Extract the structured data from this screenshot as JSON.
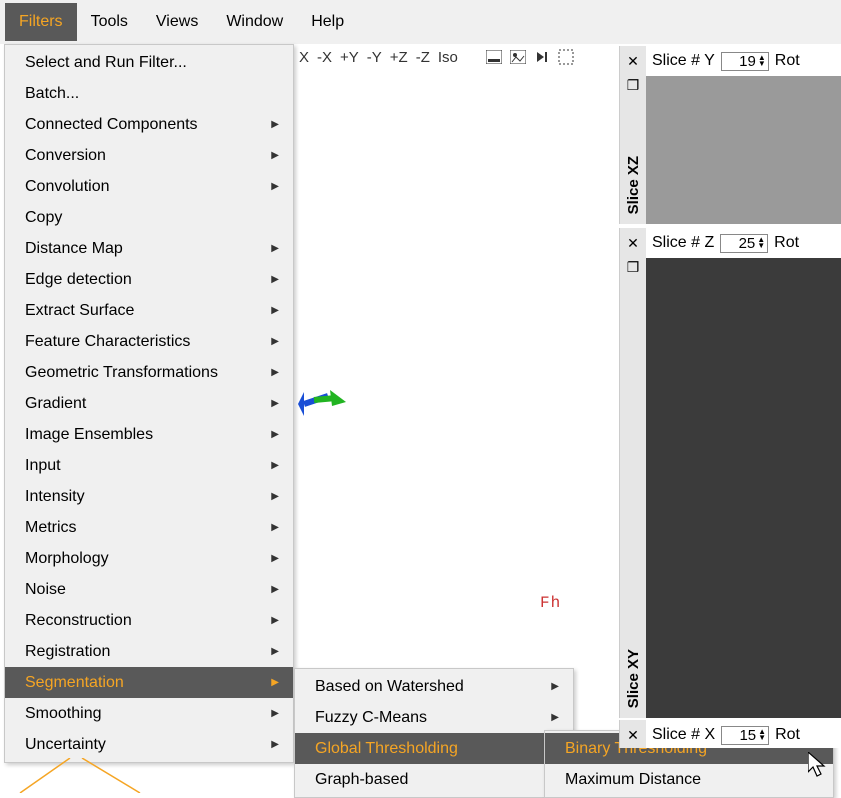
{
  "menubar": {
    "items": [
      {
        "label": "Filters",
        "active": true
      },
      {
        "label": "Tools"
      },
      {
        "label": "Views"
      },
      {
        "label": "Window"
      },
      {
        "label": "Help"
      }
    ]
  },
  "filters_menu": {
    "items": [
      {
        "label": "Select and Run Filter..."
      },
      {
        "label": "Batch..."
      },
      {
        "label": "Connected Components",
        "submenu": true
      },
      {
        "label": "Conversion",
        "submenu": true
      },
      {
        "label": "Convolution",
        "submenu": true
      },
      {
        "label": "Copy"
      },
      {
        "label": "Distance Map",
        "submenu": true
      },
      {
        "label": "Edge detection",
        "submenu": true
      },
      {
        "label": "Extract Surface",
        "submenu": true
      },
      {
        "label": "Feature Characteristics",
        "submenu": true
      },
      {
        "label": "Geometric Transformations",
        "submenu": true
      },
      {
        "label": "Gradient",
        "submenu": true
      },
      {
        "label": "Image Ensembles",
        "submenu": true
      },
      {
        "label": "Input",
        "submenu": true
      },
      {
        "label": "Intensity",
        "submenu": true
      },
      {
        "label": "Metrics",
        "submenu": true
      },
      {
        "label": "Morphology",
        "submenu": true
      },
      {
        "label": "Noise",
        "submenu": true
      },
      {
        "label": "Reconstruction",
        "submenu": true
      },
      {
        "label": "Registration",
        "submenu": true
      },
      {
        "label": "Segmentation",
        "submenu": true,
        "highlight": true
      },
      {
        "label": "Smoothing",
        "submenu": true
      },
      {
        "label": "Uncertainty",
        "submenu": true
      }
    ]
  },
  "segmentation_menu": {
    "items": [
      {
        "label": "Based on Watershed",
        "submenu": true
      },
      {
        "label": "Fuzzy C-Means",
        "submenu": true
      },
      {
        "label": "Global Thresholding",
        "submenu": true,
        "highlight": true
      },
      {
        "label": "Graph-based",
        "submenu": true
      }
    ]
  },
  "thresholding_menu": {
    "items": [
      {
        "label": "Binary Thresholding",
        "highlight": true
      },
      {
        "label": "Maximum Distance"
      }
    ]
  },
  "axisbar": {
    "items": [
      "X",
      "-X",
      "+Y",
      "-Y",
      "+Z",
      "-Z",
      "Iso"
    ]
  },
  "panels": {
    "xz": {
      "title": "Slice XZ",
      "label": "Slice # Y",
      "value": "19",
      "rot": "Rot"
    },
    "xy": {
      "title": "Slice XY",
      "label": "Slice # Z",
      "value": "25",
      "rot": "Rot"
    },
    "bottom": {
      "label": "Slice # X",
      "value": "15",
      "rot": "Rot"
    }
  },
  "brand": "Fh"
}
